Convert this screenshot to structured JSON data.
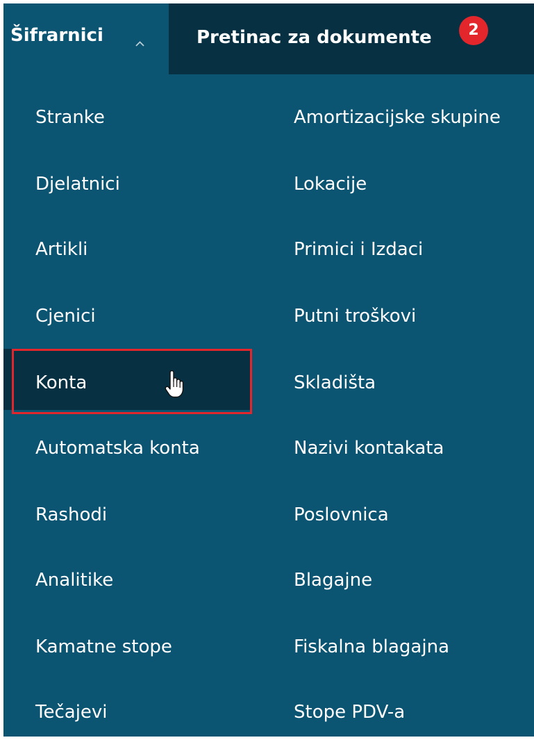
{
  "header": {
    "tab_sifrarnici": "Šifrarnici",
    "tab_pretinac": "Pretinac za dokumente",
    "pretinac_badge": "2",
    "chevron_icon": "chevron-up-icon"
  },
  "menu": {
    "column1": [
      {
        "label": "Stranke"
      },
      {
        "label": "Djelatnici"
      },
      {
        "label": "Artikli"
      },
      {
        "label": "Cjenici"
      },
      {
        "label": "Konta"
      },
      {
        "label": "Automatska konta"
      },
      {
        "label": "Rashodi"
      },
      {
        "label": "Analitike"
      },
      {
        "label": "Kamatne stope"
      },
      {
        "label": "Tečajevi"
      }
    ],
    "column2": [
      {
        "label": "Amortizacijske skupine"
      },
      {
        "label": "Lokacije"
      },
      {
        "label": "Primici i Izdaci"
      },
      {
        "label": "Putni troškovi"
      },
      {
        "label": "Skladišta"
      },
      {
        "label": "Nazivi kontakata"
      },
      {
        "label": "Poslovnica"
      },
      {
        "label": "Blagajne"
      },
      {
        "label": "Fiskalna blagajna"
      },
      {
        "label": "Stope PDV-a"
      }
    ],
    "active_item": "Konta"
  },
  "colors": {
    "menu_background": "#0b5572",
    "topbar_background": "#073142",
    "active_item_background": "#073142",
    "badge": "#e3262b",
    "highlight_border": "#e3262b",
    "text": "#ffffff"
  },
  "cursor_icon": "hand-pointer-icon"
}
